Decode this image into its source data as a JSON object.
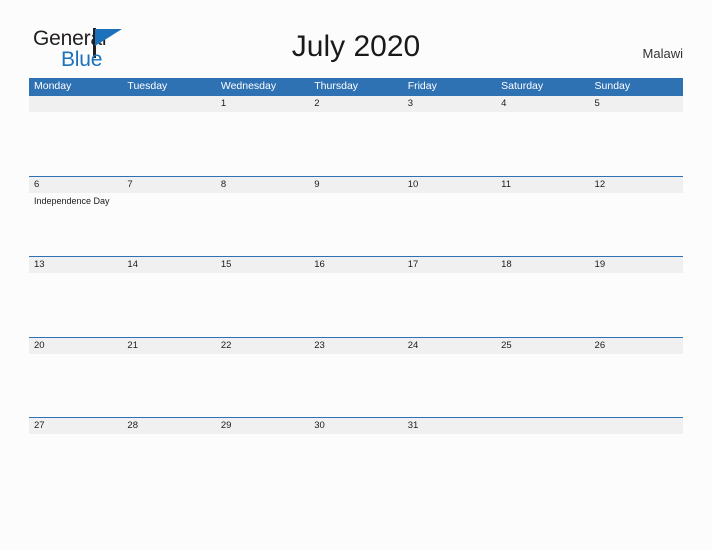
{
  "brand": {
    "name_part1": "General",
    "name_part2": "Blue",
    "triangle_color": "#1b72ba",
    "text_color": "#231f20"
  },
  "header": {
    "title": "July 2020",
    "country": "Malawi",
    "accent_color": "#2f72b4",
    "band_color": "#f0f0f0",
    "page_background": "#fcfcfd"
  },
  "calendar": {
    "weekdays": [
      "Monday",
      "Tuesday",
      "Wednesday",
      "Thursday",
      "Friday",
      "Saturday",
      "Sunday"
    ],
    "weeks": [
      {
        "days": [
          {
            "date": "",
            "events": []
          },
          {
            "date": "",
            "events": []
          },
          {
            "date": "1",
            "events": []
          },
          {
            "date": "2",
            "events": []
          },
          {
            "date": "3",
            "events": []
          },
          {
            "date": "4",
            "events": []
          },
          {
            "date": "5",
            "events": []
          }
        ]
      },
      {
        "days": [
          {
            "date": "6",
            "events": [
              "Independence Day"
            ]
          },
          {
            "date": "7",
            "events": []
          },
          {
            "date": "8",
            "events": []
          },
          {
            "date": "9",
            "events": []
          },
          {
            "date": "10",
            "events": []
          },
          {
            "date": "11",
            "events": []
          },
          {
            "date": "12",
            "events": []
          }
        ]
      },
      {
        "days": [
          {
            "date": "13",
            "events": []
          },
          {
            "date": "14",
            "events": []
          },
          {
            "date": "15",
            "events": []
          },
          {
            "date": "16",
            "events": []
          },
          {
            "date": "17",
            "events": []
          },
          {
            "date": "18",
            "events": []
          },
          {
            "date": "19",
            "events": []
          }
        ]
      },
      {
        "days": [
          {
            "date": "20",
            "events": []
          },
          {
            "date": "21",
            "events": []
          },
          {
            "date": "22",
            "events": []
          },
          {
            "date": "23",
            "events": []
          },
          {
            "date": "24",
            "events": []
          },
          {
            "date": "25",
            "events": []
          },
          {
            "date": "26",
            "events": []
          }
        ]
      },
      {
        "days": [
          {
            "date": "27",
            "events": []
          },
          {
            "date": "28",
            "events": []
          },
          {
            "date": "29",
            "events": []
          },
          {
            "date": "30",
            "events": []
          },
          {
            "date": "31",
            "events": []
          },
          {
            "date": "",
            "events": []
          },
          {
            "date": "",
            "events": []
          }
        ]
      }
    ]
  }
}
